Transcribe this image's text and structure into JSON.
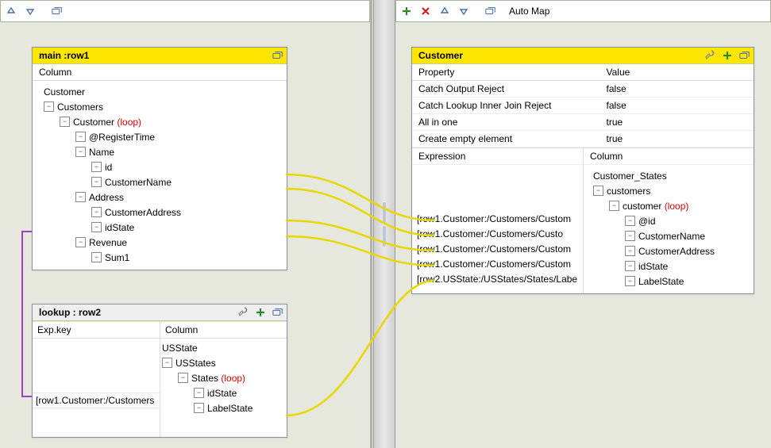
{
  "left_toolbar": {
    "items": [
      "up",
      "down",
      "minimize"
    ]
  },
  "right_toolbar": {
    "auto_map": "Auto Map"
  },
  "main_panel": {
    "title": "main :row1",
    "column_label": "Column",
    "tree": {
      "root": "Customer",
      "customers": "Customers",
      "customer": "Customer",
      "loop": "(loop)",
      "registerTime": "@RegisterTime",
      "name": "Name",
      "id": "id",
      "customerName": "CustomerName",
      "address": "Address",
      "customerAddress": "CustomerAddress",
      "idState": "idState",
      "revenue": "Revenue",
      "sum1": "Sum1"
    }
  },
  "lookup_panel": {
    "title": "lookup : row2",
    "expkey_label": "Exp.key",
    "column_label": "Column",
    "expr": "[row1.Customer:/Customers",
    "tree": {
      "root": "USState",
      "usstates": "USStates",
      "states": "States",
      "loop": "(loop)",
      "idState": "idState",
      "labelState": "LabelState"
    }
  },
  "customer_panel": {
    "title": "Customer",
    "prop_header": "Property",
    "val_header": "Value",
    "props": [
      {
        "k": "Catch Output Reject",
        "v": "false"
      },
      {
        "k": "Catch Lookup Inner Join Reject",
        "v": "false"
      },
      {
        "k": "All in one",
        "v": "true"
      },
      {
        "k": "Create empty element",
        "v": "true"
      }
    ],
    "expr_label": "Expression",
    "column_label": "Column",
    "exprs": [
      "[row1.Customer:/Customers/Custom",
      "[row1.Customer:/Customers/Custo",
      "[row1.Customer:/Customers/Custom",
      "[row1.Customer:/Customers/Custom",
      "[row2.USState:/USStates/States/Labe"
    ],
    "tree": {
      "root": "Customer_States",
      "customers": "customers",
      "customer": "customer",
      "loop": "(loop)",
      "id": "@id",
      "customerName": "CustomerName",
      "customerAddress": "CustomerAddress",
      "idState": "idState",
      "labelState": "LabelState"
    }
  }
}
